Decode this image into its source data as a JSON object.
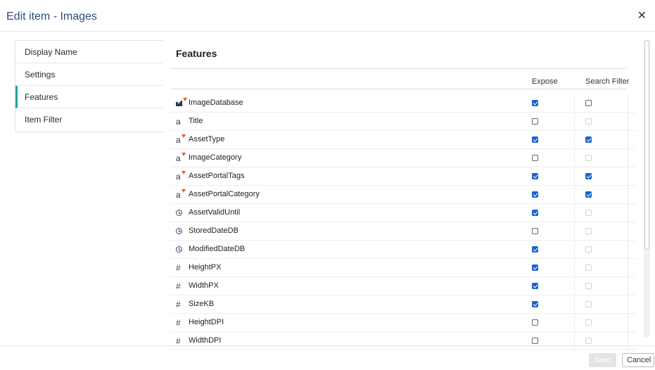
{
  "dialog": {
    "title": "Edit item - Images",
    "close_icon": "close-icon"
  },
  "nav": {
    "items": [
      {
        "label": "Display Name",
        "active": false
      },
      {
        "label": "Settings",
        "active": false
      },
      {
        "label": "Features",
        "active": true
      },
      {
        "label": "Item Filter",
        "active": false
      }
    ]
  },
  "panel": {
    "section_title": "Features",
    "columns": {
      "expose": "Expose",
      "search_filter": "Search Filter"
    },
    "rows": [
      {
        "name": "ImageDatabase",
        "icon": "database-icon",
        "expose": true,
        "search": false,
        "search_enabled": true
      },
      {
        "name": "Title",
        "icon": "text-icon",
        "expose": false,
        "search": false,
        "search_enabled": false
      },
      {
        "name": "AssetType",
        "icon": "text-filter-icon",
        "expose": true,
        "search": true,
        "search_enabled": true
      },
      {
        "name": "ImageCategory",
        "icon": "text-filter-icon",
        "expose": false,
        "search": false,
        "search_enabled": false
      },
      {
        "name": "AssetPortalTags",
        "icon": "text-filter-icon",
        "expose": true,
        "search": true,
        "search_enabled": true
      },
      {
        "name": "AssetPortalCategory",
        "icon": "text-filter-icon",
        "expose": true,
        "search": true,
        "search_enabled": true
      },
      {
        "name": "AssetValidUntil",
        "icon": "clock-icon",
        "expose": true,
        "search": false,
        "search_enabled": false
      },
      {
        "name": "StoredDateDB",
        "icon": "clock-icon",
        "expose": false,
        "search": false,
        "search_enabled": false
      },
      {
        "name": "ModifiedDateDB",
        "icon": "clock-icon",
        "expose": true,
        "search": false,
        "search_enabled": false
      },
      {
        "name": "HeightPX",
        "icon": "number-icon",
        "expose": true,
        "search": false,
        "search_enabled": false
      },
      {
        "name": "WidthPX",
        "icon": "number-icon",
        "expose": true,
        "search": false,
        "search_enabled": false
      },
      {
        "name": "SizeKB",
        "icon": "number-icon",
        "expose": true,
        "search": false,
        "search_enabled": false
      },
      {
        "name": "HeightDPI",
        "icon": "number-icon",
        "expose": false,
        "search": false,
        "search_enabled": false
      },
      {
        "name": "WidthDPI",
        "icon": "number-icon",
        "expose": false,
        "search": false,
        "search_enabled": false
      }
    ]
  },
  "footer": {
    "save_label": "Save",
    "cancel_label": "Cancel"
  },
  "colors": {
    "accent": "#1fa59d",
    "checkbox": "#1b62c7",
    "title": "#2f4a7a",
    "filter_marker": "#e0602a"
  }
}
